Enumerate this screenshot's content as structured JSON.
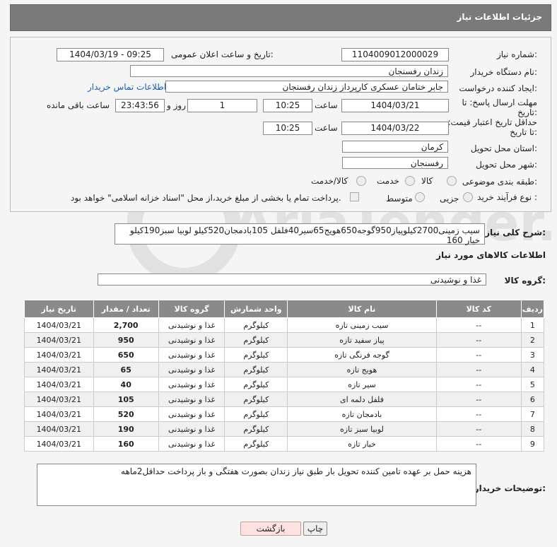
{
  "header": {
    "title": "جزئیات اطلاعات نیاز"
  },
  "form": {
    "need_number_label": "شماره نیاز:",
    "need_number": "1104009012000029",
    "announce_label": "تاریخ و ساعت اعلان عمومی:",
    "announce_value": "1404/03/19 - 09:25",
    "buyer_org_label": "نام دستگاه خریدار:",
    "buyer_org": "زندان رفسنجان",
    "creator_label": "ایجاد کننده درخواست:",
    "creator": "جابر ختامان عسکری کارپرداز زندان رفسنجان",
    "contact_link": "اطلاعات تماس خریدار",
    "deadline_label": "مهلت ارسال پاسخ: تا تاریخ:",
    "deadline_date": "1404/03/21",
    "time_label": "ساعت",
    "deadline_time": "10:25",
    "days_value": "1",
    "days_label": "روز و",
    "remaining_time": "23:43:56",
    "remaining_label": "ساعت باقی مانده",
    "price_validity_label": "حداقل تاریخ اعتبار قیمت: تا تاریخ:",
    "validity_date": "1404/03/22",
    "validity_time": "10:25",
    "province_label": "استان محل تحویل:",
    "province": "کرمان",
    "city_label": "شهر محل تحویل:",
    "city": "رفسنجان",
    "category_label": "طبقه بندی موضوعی:",
    "category_options": [
      "کالا",
      "خدمت",
      "کالا/خدمت"
    ],
    "process_label": "نوع فرآیند خرید :",
    "process_options": [
      "جزیی",
      "متوسط"
    ],
    "payment_note": "پرداخت تمام یا بخشی از مبلغ خرید،از محل \"اسناد خزانه اسلامی\" خواهد بود."
  },
  "description": {
    "label": "شرح کلی نیاز:",
    "text": "سیب زمینی2700کیلوپیاز950گوجه650هویج65سیر40فلفل 105بادمجان520کیلو لوبیا سبز190کیلو خیار 160"
  },
  "goods_info_title": "اطلاعات کالاهای مورد نیاز",
  "goods_group": {
    "label": "گروه کالا:",
    "value": "غذا و نوشیدنی"
  },
  "table": {
    "headers": [
      "ردیف",
      "کد کالا",
      "نام کالا",
      "واحد شمارش",
      "گروه کالا",
      "تعداد / مقدار",
      "تاریخ نیاز"
    ],
    "rows": [
      [
        "1",
        "--",
        "سیب زمینی تازه",
        "کیلوگرم",
        "غذا و نوشیدنی",
        "2,700",
        "1404/03/21"
      ],
      [
        "2",
        "--",
        "پیاز سفید تازه",
        "کیلوگرم",
        "غذا و نوشیدنی",
        "950",
        "1404/03/21"
      ],
      [
        "3",
        "--",
        "گوجه فرنگی تازه",
        "کیلوگرم",
        "غذا و نوشیدنی",
        "650",
        "1404/03/21"
      ],
      [
        "4",
        "--",
        "هویج تازه",
        "کیلوگرم",
        "غذا و نوشیدنی",
        "65",
        "1404/03/21"
      ],
      [
        "5",
        "--",
        "سیر تازه",
        "کیلوگرم",
        "غذا و نوشیدنی",
        "40",
        "1404/03/21"
      ],
      [
        "6",
        "--",
        "فلفل دلمه ای",
        "کیلوگرم",
        "غذا و نوشیدنی",
        "105",
        "1404/03/21"
      ],
      [
        "7",
        "--",
        "بادمجان تازه",
        "کیلوگرم",
        "غذا و نوشیدنی",
        "520",
        "1404/03/21"
      ],
      [
        "8",
        "--",
        "لوبیا سبز تازه",
        "کیلوگرم",
        "غذا و نوشیدنی",
        "190",
        "1404/03/21"
      ],
      [
        "9",
        "--",
        "خیار تازه",
        "کیلوگرم",
        "غذا و نوشیدنی",
        "160",
        "1404/03/21"
      ]
    ]
  },
  "buyer_notes": {
    "label": "توضیحات خریدار:",
    "text": "هزینه حمل بر عهده تامین کننده تحویل بار طبق نیاز زندان بصورت هفتگی و باز پرداخت حداقل2ماهه"
  },
  "buttons": {
    "print": "چاپ",
    "back": "بازگشت"
  },
  "watermark": {
    "text": "AriaTender.net"
  }
}
